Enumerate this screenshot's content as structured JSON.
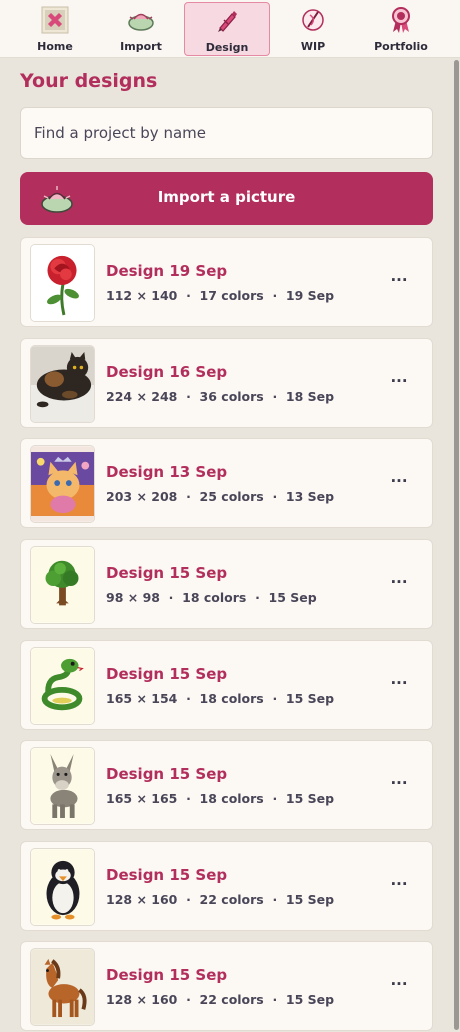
{
  "nav": {
    "items": [
      {
        "label": "Home",
        "icon": "home-stitch-icon"
      },
      {
        "label": "Import",
        "icon": "import-landscape-icon"
      },
      {
        "label": "Design",
        "icon": "design-pen-icon",
        "active": true
      },
      {
        "label": "WIP",
        "icon": "wip-needle-icon"
      },
      {
        "label": "Portfolio",
        "icon": "portfolio-rosette-icon"
      }
    ]
  },
  "page": {
    "title": "Your designs",
    "search_placeholder": "Find a project by name",
    "import_label": "Import a picture",
    "accent": "#b22e5c"
  },
  "designs": [
    {
      "name": "Design 19 Sep",
      "size": "112 × 140",
      "colors": "17 colors",
      "date": "19 Sep",
      "thumb": "rose",
      "more": "···"
    },
    {
      "name": "Design 16 Sep",
      "size": "224 × 248",
      "colors": "36 colors",
      "date": "18 Sep",
      "thumb": "cat",
      "more": "···"
    },
    {
      "name": "Design 13 Sep",
      "size": "203 × 208",
      "colors": "25 colors",
      "date": "13 Sep",
      "thumb": "kitten",
      "more": "···"
    },
    {
      "name": "Design 15 Sep",
      "size": "98 × 98",
      "colors": "18 colors",
      "date": "15 Sep",
      "thumb": "tree",
      "more": "···"
    },
    {
      "name": "Design 15 Sep",
      "size": "165 × 154",
      "colors": "18 colors",
      "date": "15 Sep",
      "thumb": "snake",
      "more": "···"
    },
    {
      "name": "Design 15 Sep",
      "size": "165 × 165",
      "colors": "18 colors",
      "date": "15 Sep",
      "thumb": "donkey",
      "more": "···"
    },
    {
      "name": "Design 15 Sep",
      "size": "128 × 160",
      "colors": "22 colors",
      "date": "15 Sep",
      "thumb": "penguin",
      "more": "···"
    },
    {
      "name": "Design 15 Sep",
      "size": "128 × 160",
      "colors": "22 colors",
      "date": "15 Sep",
      "thumb": "horse",
      "more": "···"
    }
  ]
}
